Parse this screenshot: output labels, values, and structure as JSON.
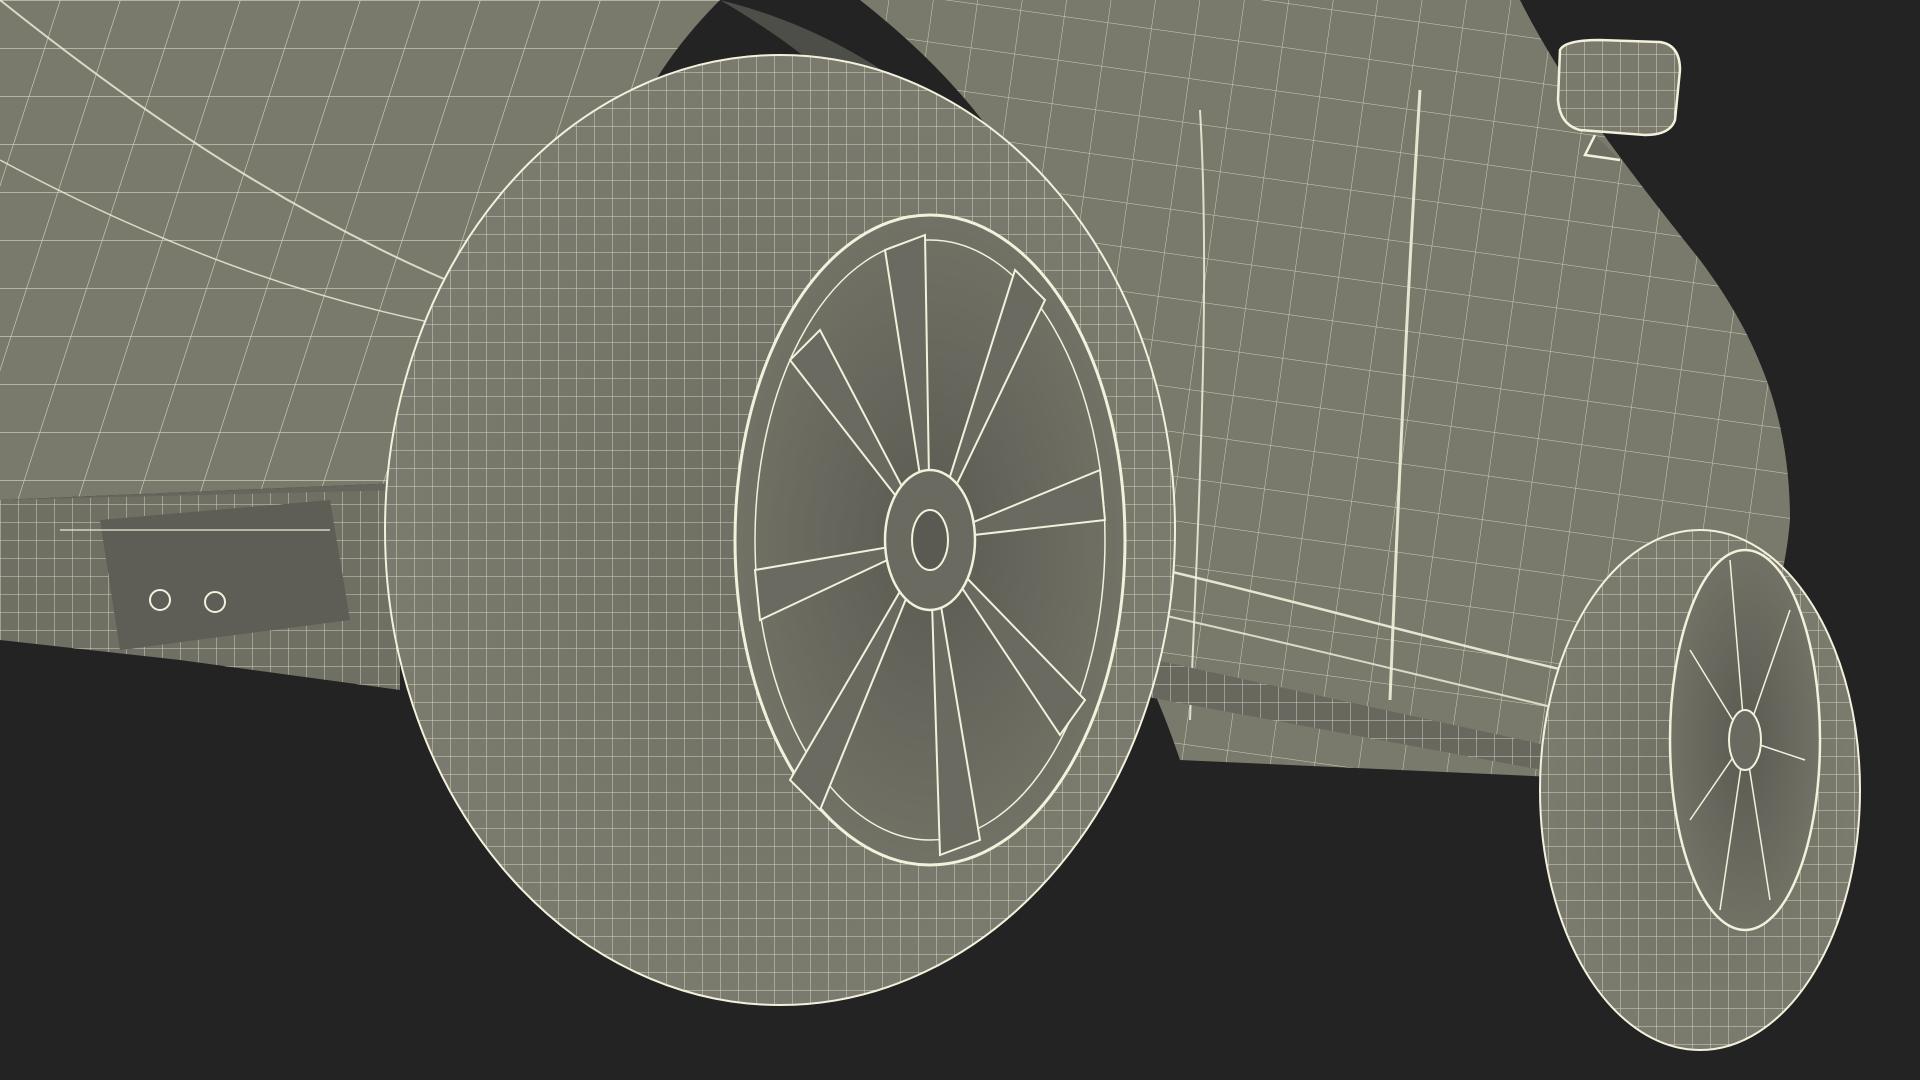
{
  "scene": {
    "subject": "car-wireframe-render",
    "colors": {
      "background": "#232323",
      "surface": "#7a7a6c",
      "surface_dark": "#62625a",
      "shadow": "#4a4a44",
      "wire": "#f3f1dc"
    }
  }
}
